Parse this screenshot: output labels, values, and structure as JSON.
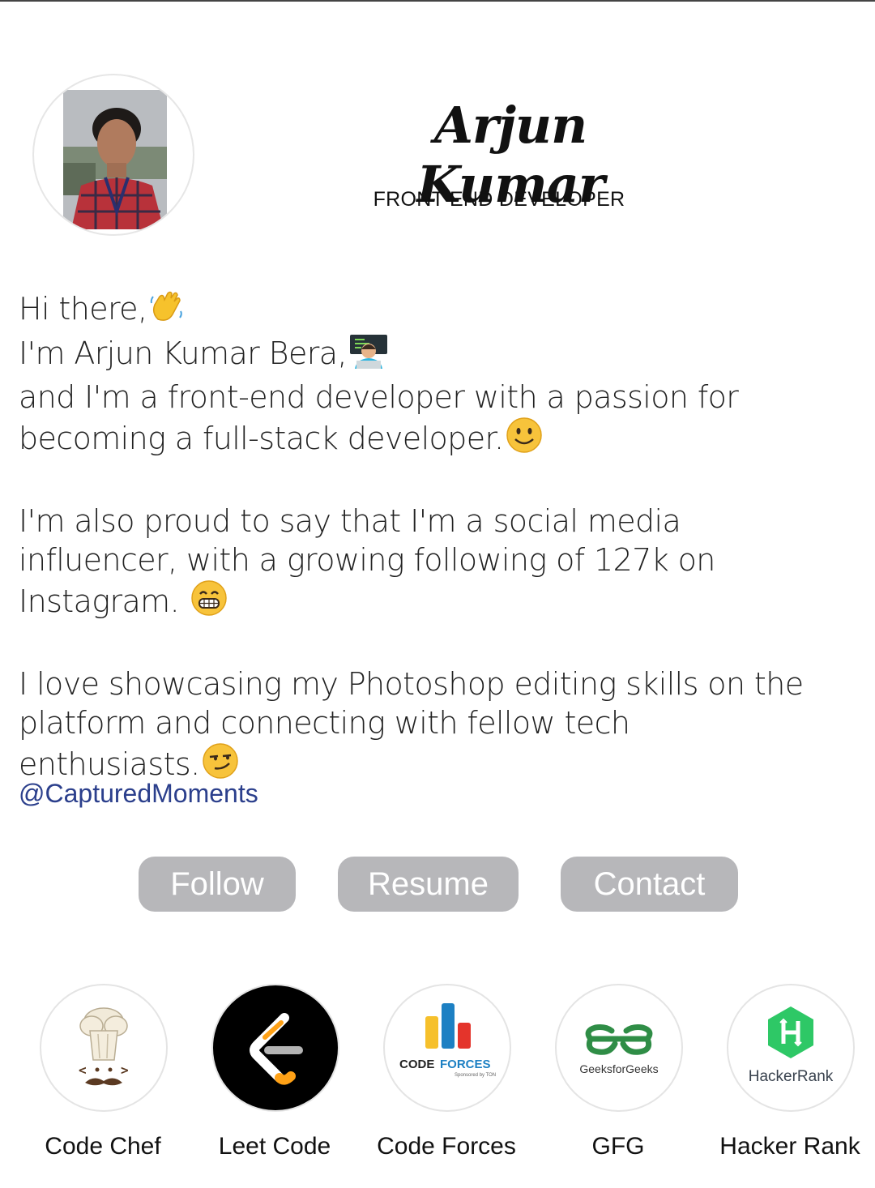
{
  "profile": {
    "name": "Arjun Kumar",
    "role": "FRONT END DEVELOPER",
    "avatar_icon": "profile-photo"
  },
  "bio": {
    "line1": "Hi there,",
    "line2": "I'm Arjun Kumar Bera,",
    "line3": "and I'm a front-end developer with a passion for",
    "line4": "becoming a full-stack developer.",
    "line5": "I'm also proud to say that I'm a social media",
    "line6": "influencer, with a growing following of 127k on",
    "line7": "Instagram.",
    "line8": "I love showcasing my Photoshop editing skills on the",
    "line9": "platform and connecting with fellow tech",
    "line10": "enthusiasts."
  },
  "handle": "@CapturedMoments",
  "buttons": {
    "follow": "Follow",
    "resume": "Resume",
    "contact": "Contact"
  },
  "platforms": [
    {
      "label": "Code Chef",
      "icon": "codechef-chef-hat-icon"
    },
    {
      "label": "Leet Code",
      "icon": "leetcode-icon"
    },
    {
      "label": "Code Forces",
      "icon": "codeforces-icon"
    },
    {
      "label": "GFG",
      "icon": "geeksforgeeks-icon"
    },
    {
      "label": "Hacker Rank",
      "icon": "hackerrank-icon"
    }
  ],
  "platform_logo_text": {
    "codeforces_code": "CODE",
    "codeforces_forces": "FORCES",
    "codeforces_sponsor": "Sponsored by TON",
    "gfg": "GeeksforGeeks",
    "hackerrank": "HackerRank"
  },
  "colors": {
    "button_bg": "#b7b7ba",
    "handle": "#2b3f8c",
    "hackerrank_green": "#2ec866",
    "gfg_green": "#2f8d46"
  }
}
